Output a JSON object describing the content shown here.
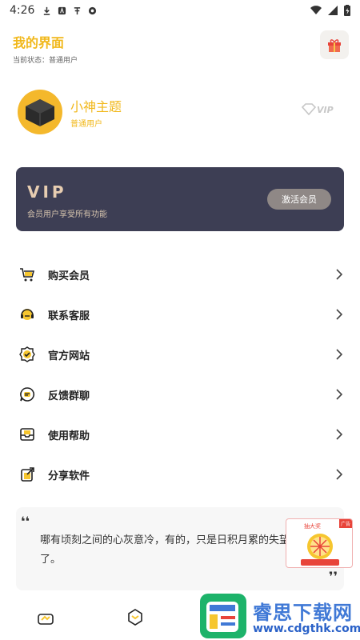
{
  "status_bar": {
    "time": "4:26"
  },
  "header": {
    "title": "我的界面",
    "subtitle": "当前状态：普通用户"
  },
  "profile": {
    "username": "小神主题",
    "level": "普通用户",
    "badge": "VIP"
  },
  "vip_card": {
    "title": "VIP",
    "description": "会员用户享受所有功能",
    "button_label": "激活会员"
  },
  "menu": {
    "items": [
      {
        "label": "购买会员",
        "icon": "cart-icon"
      },
      {
        "label": "联系客服",
        "icon": "headset-icon"
      },
      {
        "label": "官方网站",
        "icon": "badge-check-icon"
      },
      {
        "label": "反馈群聊",
        "icon": "chat-icon"
      },
      {
        "label": "使用帮助",
        "icon": "inbox-icon"
      },
      {
        "label": "分享软件",
        "icon": "share-icon"
      }
    ]
  },
  "quote": {
    "open_mark": "❛❛",
    "text": "哪有顷刻之间的心灰意冷，有的，只是日积月累的失望罢了。",
    "close_mark": "❜❜"
  },
  "lottery_ad": {
    "title": "抽大奖",
    "tag": "广告"
  },
  "watermark": {
    "title": "睿思下载网",
    "url": "www.cdgthk.com"
  },
  "colors": {
    "accent": "#f1b81c",
    "vip_card_bg": "#3d3e54",
    "vip_gold": "#e7cdb1"
  }
}
